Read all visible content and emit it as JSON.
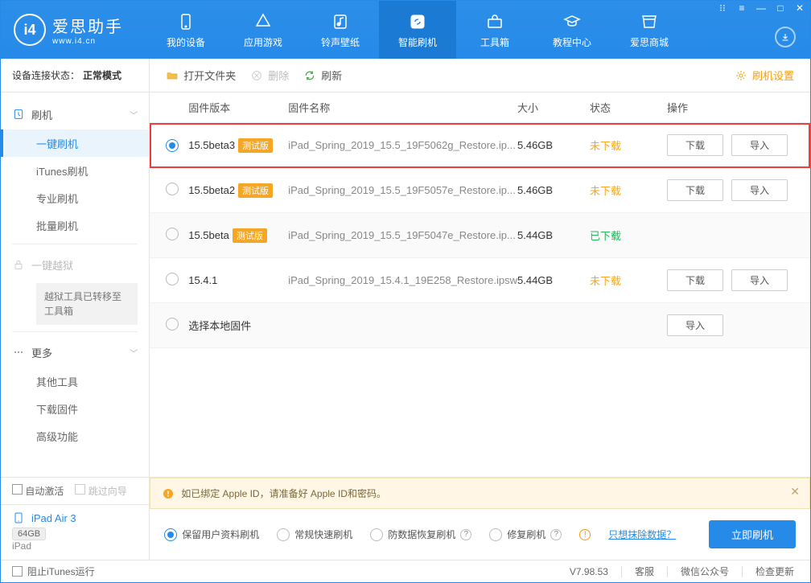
{
  "brand": {
    "cn": "爱思助手",
    "en": "www.i4.cn"
  },
  "nav": {
    "items": [
      {
        "label": "我的设备"
      },
      {
        "label": "应用游戏"
      },
      {
        "label": "铃声壁纸"
      },
      {
        "label": "智能刷机"
      },
      {
        "label": "工具箱"
      },
      {
        "label": "教程中心"
      },
      {
        "label": "爱思商城"
      }
    ],
    "active_index": 3
  },
  "sidebar": {
    "status_label": "设备连接状态：",
    "status_value": "正常模式",
    "cat_flash": "刷机",
    "items_flash": [
      "一键刷机",
      "iTunes刷机",
      "专业刷机",
      "批量刷机"
    ],
    "cat_jailbreak": "一键越狱",
    "jailbreak_note": "越狱工具已转移至工具箱",
    "cat_more": "更多",
    "items_more": [
      "其他工具",
      "下载固件",
      "高级功能"
    ],
    "auto_activate": "自动激活",
    "skip_guide": "跳过向导",
    "device": {
      "name": "iPad Air 3",
      "storage": "64GB",
      "type": "iPad"
    }
  },
  "toolbar": {
    "open": "打开文件夹",
    "delete": "删除",
    "refresh": "刷新",
    "settings": "刷机设置"
  },
  "columns": {
    "ver": "固件版本",
    "name": "固件名称",
    "size": "大小",
    "stat": "状态",
    "ops": "操作"
  },
  "rows": [
    {
      "ver": "15.5beta3",
      "beta": "测试版",
      "name": "iPad_Spring_2019_15.5_19F5062g_Restore.ip...",
      "size": "5.46GB",
      "stat": "未下载",
      "stat_cls": "orange",
      "dl": "下载",
      "imp": "导入",
      "sel": true,
      "hl": true
    },
    {
      "ver": "15.5beta2",
      "beta": "测试版",
      "name": "iPad_Spring_2019_15.5_19F5057e_Restore.ip...",
      "size": "5.46GB",
      "stat": "未下载",
      "stat_cls": "orange",
      "dl": "下载",
      "imp": "导入"
    },
    {
      "ver": "15.5beta",
      "beta": "测试版",
      "name": "iPad_Spring_2019_15.5_19F5047e_Restore.ip...",
      "size": "5.44GB",
      "stat": "已下载",
      "stat_cls": "green",
      "alt": true
    },
    {
      "ver": "15.4.1",
      "name": "iPad_Spring_2019_15.4.1_19E258_Restore.ipsw",
      "size": "5.44GB",
      "stat": "未下载",
      "stat_cls": "orange",
      "dl": "下载",
      "imp": "导入"
    },
    {
      "ver": "选择本地固件",
      "local": true,
      "imp": "导入",
      "alt": true
    }
  ],
  "notice": "如已绑定 Apple ID，请准备好 Apple ID和密码。",
  "opts": {
    "keep_data": "保留用户资料刷机",
    "normal": "常规快速刷机",
    "anti_loss": "防数据恢复刷机",
    "repair": "修复刷机",
    "erase_link": "只想抹除数据？",
    "go": "立即刷机"
  },
  "footer": {
    "block_itunes": "阻止iTunes运行",
    "version": "V7.98.53",
    "support": "客服",
    "wechat": "微信公众号",
    "update": "检查更新"
  }
}
